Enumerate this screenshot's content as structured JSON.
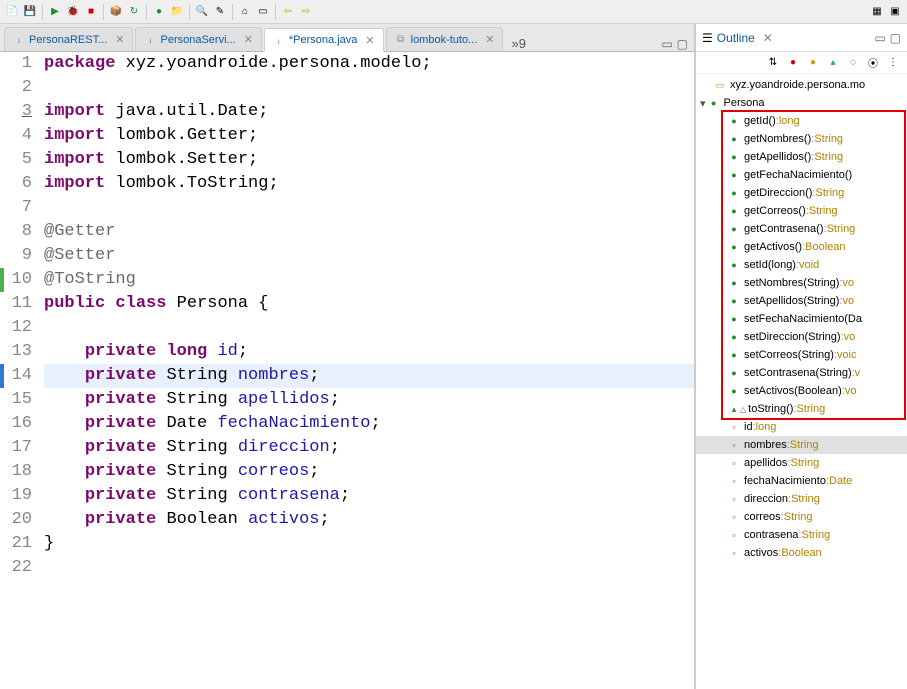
{
  "tabs": [
    {
      "icon": "J",
      "label": "PersonaREST...",
      "active": false
    },
    {
      "icon": "J",
      "label": "PersonaServi...",
      "active": false
    },
    {
      "icon": "J",
      "label": "*Persona.java",
      "active": true
    },
    {
      "icon": "x",
      "label": "lombok-tuto...",
      "active": false
    }
  ],
  "tab_overflow": "»9",
  "outline_title": "Outline",
  "code": [
    {
      "n": 1,
      "marks": [],
      "html": "<span class='kw'>package</span> <span class='pkg'>xyz.yoandroide.persona.modelo;</span>"
    },
    {
      "n": 2,
      "marks": [],
      "html": ""
    },
    {
      "n": 3,
      "marks": [
        "error"
      ],
      "html": "<span class='kw'>import</span> <span class='pkg'>java.util.Date;</span>"
    },
    {
      "n": 4,
      "marks": [],
      "html": "<span class='kw'>import</span> <span class='pkg'>lombok.Getter;</span>"
    },
    {
      "n": 5,
      "marks": [],
      "html": "<span class='kw'>import</span> <span class='pkg'>lombok.Setter;</span>"
    },
    {
      "n": 6,
      "marks": [],
      "html": "<span class='kw'>import</span> <span class='pkg'>lombok.ToString;</span>"
    },
    {
      "n": 7,
      "marks": [],
      "html": ""
    },
    {
      "n": 8,
      "marks": [],
      "html": "<span class='ann'>@Getter</span>"
    },
    {
      "n": 9,
      "marks": [],
      "html": "<span class='ann'>@Setter</span>"
    },
    {
      "n": 10,
      "marks": [
        "green"
      ],
      "html": "<span class='ann'>@ToString</span>"
    },
    {
      "n": 11,
      "marks": [],
      "html": "<span class='kw'>public</span> <span class='kw'>class</span> <span class='type'>Persona</span> <span class='pun'>{</span>"
    },
    {
      "n": 12,
      "marks": [],
      "html": ""
    },
    {
      "n": 13,
      "marks": [],
      "html": "    <span class='kw'>private</span> <span class='kw'>long</span> <span class='ident'>id</span><span class='pun'>;</span>"
    },
    {
      "n": 14,
      "marks": [
        "cursor"
      ],
      "current": true,
      "html": "    <span class='kw'>private</span> <span class='type'>String</span> <span class='ident'>nombres</span><span class='pun'>;</span>"
    },
    {
      "n": 15,
      "marks": [],
      "html": "    <span class='kw'>private</span> <span class='type'>String</span> <span class='ident'>apellidos</span><span class='pun'>;</span>"
    },
    {
      "n": 16,
      "marks": [],
      "html": "    <span class='kw'>private</span> <span class='type'>Date</span> <span class='ident'>fechaNacimiento</span><span class='pun'>;</span>"
    },
    {
      "n": 17,
      "marks": [],
      "html": "    <span class='kw'>private</span> <span class='type'>String</span> <span class='ident'>direccion</span><span class='pun'>;</span>"
    },
    {
      "n": 18,
      "marks": [],
      "html": "    <span class='kw'>private</span> <span class='type'>String</span> <span class='ident'>correos</span><span class='pun'>;</span>"
    },
    {
      "n": 19,
      "marks": [],
      "html": "    <span class='kw'>private</span> <span class='type'>String</span> <span class='ident'>contrasena</span><span class='pun'>;</span>"
    },
    {
      "n": 20,
      "marks": [],
      "html": "    <span class='kw'>private</span> <span class='type'>Boolean</span> <span class='ident'>activos</span><span class='pun'>;</span>"
    },
    {
      "n": 21,
      "marks": [],
      "html": "<span class='pun'>}</span>"
    },
    {
      "n": 22,
      "marks": [],
      "html": ""
    }
  ],
  "outline": {
    "package": "xyz.yoandroide.persona.mo",
    "class": "Persona",
    "members": [
      {
        "kind": "method",
        "name": "getId()",
        "ret": "long",
        "boxed": true
      },
      {
        "kind": "method",
        "name": "getNombres()",
        "ret": "String",
        "boxed": true
      },
      {
        "kind": "method",
        "name": "getApellidos()",
        "ret": "String",
        "boxed": true
      },
      {
        "kind": "method",
        "name": "getFechaNacimiento()",
        "ret": "",
        "boxed": true
      },
      {
        "kind": "method",
        "name": "getDireccion()",
        "ret": "String",
        "boxed": true
      },
      {
        "kind": "method",
        "name": "getCorreos()",
        "ret": "String",
        "boxed": true
      },
      {
        "kind": "method",
        "name": "getContrasena()",
        "ret": "String",
        "boxed": true
      },
      {
        "kind": "method",
        "name": "getActivos()",
        "ret": "Boolean",
        "boxed": true
      },
      {
        "kind": "method",
        "name": "setId(long)",
        "ret": "void",
        "boxed": true
      },
      {
        "kind": "method",
        "name": "setNombres(String)",
        "ret": "vo",
        "boxed": true
      },
      {
        "kind": "method",
        "name": "setApellidos(String)",
        "ret": "vo",
        "boxed": true
      },
      {
        "kind": "method",
        "name": "setFechaNacimiento(Da",
        "ret": "",
        "boxed": true
      },
      {
        "kind": "method",
        "name": "setDireccion(String)",
        "ret": "vo",
        "boxed": true
      },
      {
        "kind": "method",
        "name": "setCorreos(String)",
        "ret": "voic",
        "boxed": true
      },
      {
        "kind": "method",
        "name": "setContrasena(String)",
        "ret": "v",
        "boxed": true
      },
      {
        "kind": "method",
        "name": "setActivos(Boolean)",
        "ret": "vo",
        "boxed": true
      },
      {
        "kind": "method-override",
        "name": "toString()",
        "ret": "String",
        "boxed": true
      },
      {
        "kind": "field",
        "name": "id",
        "ret": "long"
      },
      {
        "kind": "field",
        "name": "nombres",
        "ret": "String",
        "selected": true
      },
      {
        "kind": "field",
        "name": "apellidos",
        "ret": "String"
      },
      {
        "kind": "field",
        "name": "fechaNacimiento",
        "ret": "Date"
      },
      {
        "kind": "field",
        "name": "direccion",
        "ret": "String"
      },
      {
        "kind": "field",
        "name": "correos",
        "ret": "String"
      },
      {
        "kind": "field",
        "name": "contrasena",
        "ret": "String"
      },
      {
        "kind": "field",
        "name": "activos",
        "ret": "Boolean"
      }
    ]
  }
}
